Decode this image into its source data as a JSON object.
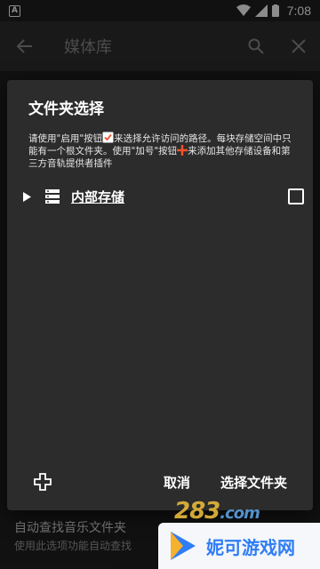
{
  "status_bar": {
    "indicator": "A",
    "time": "7:08"
  },
  "toolbar": {
    "title": "媒体库"
  },
  "dialog": {
    "title": "文件夹选择",
    "desc_part1": "请使用\"启用\"按钮",
    "desc_part2": "来选择允许访问的路径。每块存储空间中只能有一个根文件夹。使用\"加号\"按钮",
    "desc_part3": "来添加其他存储设备和第三方音轨提供者插件",
    "storage": {
      "label": "内部存储",
      "checked": false
    },
    "actions": {
      "cancel": "取消",
      "select": "选择文件夹"
    }
  },
  "background": {
    "item_title": "自动查找音乐文件夹",
    "item_subtitle": "使用此选项功能自动查找"
  },
  "watermarks": {
    "site1": "283",
    "site1_suffix": ".com",
    "site2": "妮可游戏网"
  },
  "colors": {
    "accent_check": "#ffffff",
    "plus_orange": "#f0522b",
    "brand_blue": "#2f7df6"
  }
}
